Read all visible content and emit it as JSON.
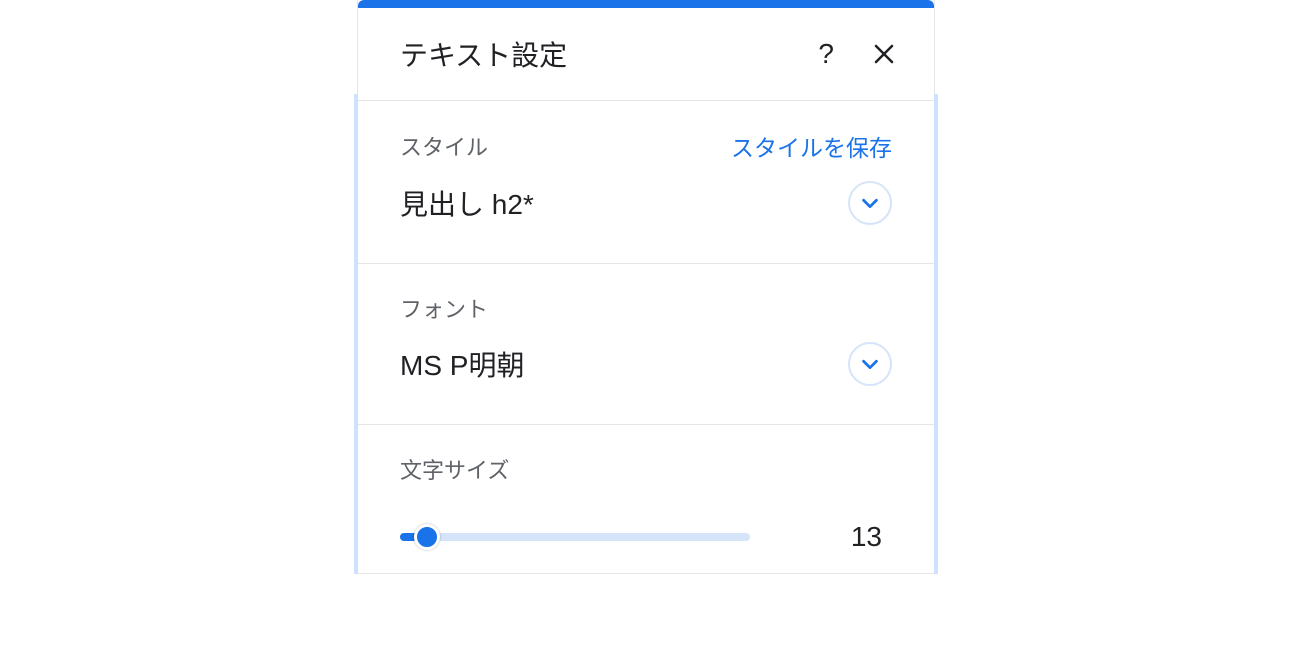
{
  "header": {
    "title": "テキスト設定"
  },
  "style_section": {
    "label": "スタイル",
    "save_link": "スタイルを保存",
    "value": "見出し h2*"
  },
  "font_section": {
    "label": "フォント",
    "value": "MS P明朝"
  },
  "size_section": {
    "label": "文字サイズ",
    "value": "13"
  }
}
